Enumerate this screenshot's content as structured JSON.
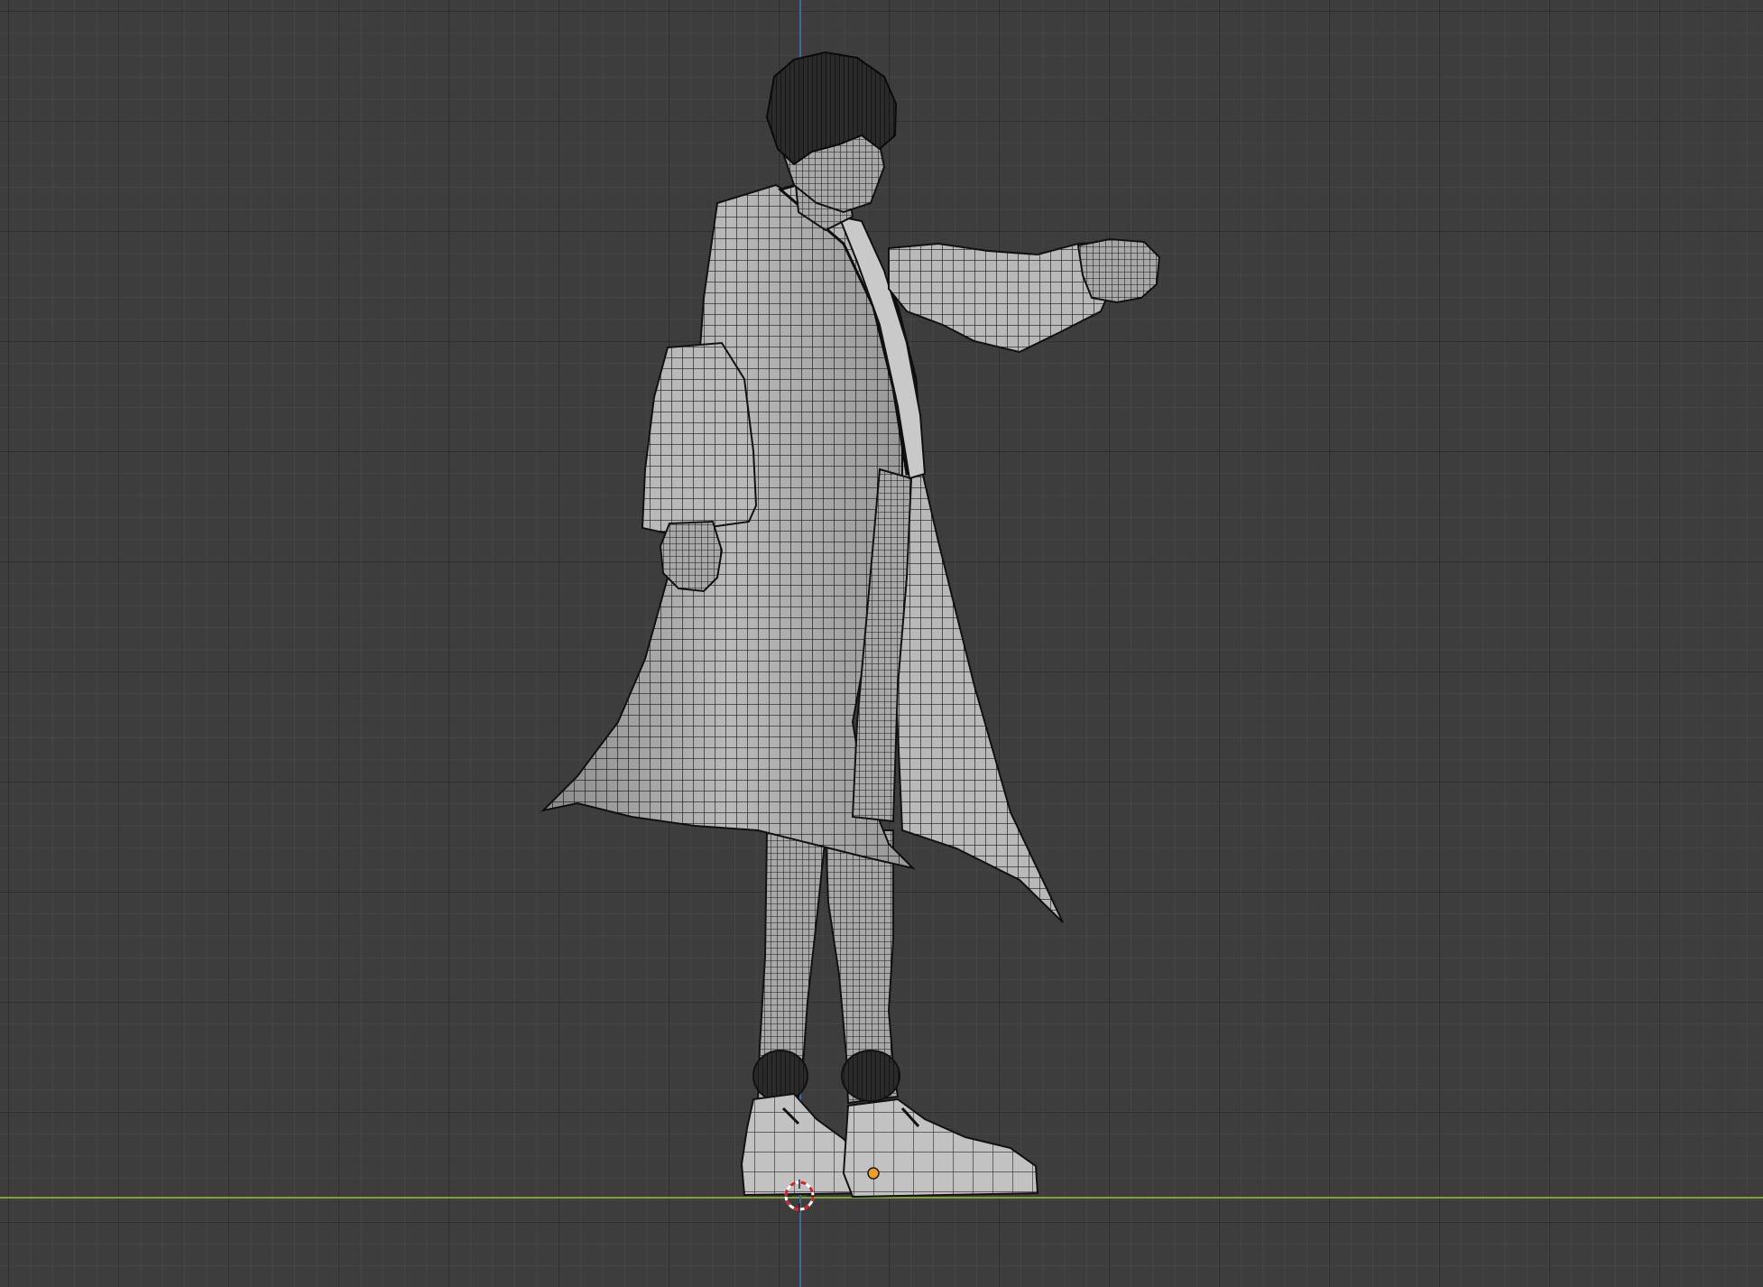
{
  "viewport": {
    "background_color": "#3d3d3d",
    "grid_minor_color": "#444444",
    "grid_major_color": "#2f2f2f",
    "axis_x_color": "#7fa13a",
    "axis_z_color": "#3f6a9c"
  },
  "scene": {
    "object": "character-mesh",
    "shading": "solid-with-wireframe",
    "mesh_face_color": "#b9b9b9",
    "mesh_wire_color": "#1a1a1a",
    "origin_dot_color": "#f0a020"
  },
  "icons": {
    "cursor": "3d-cursor-icon",
    "origin": "object-origin-icon"
  }
}
